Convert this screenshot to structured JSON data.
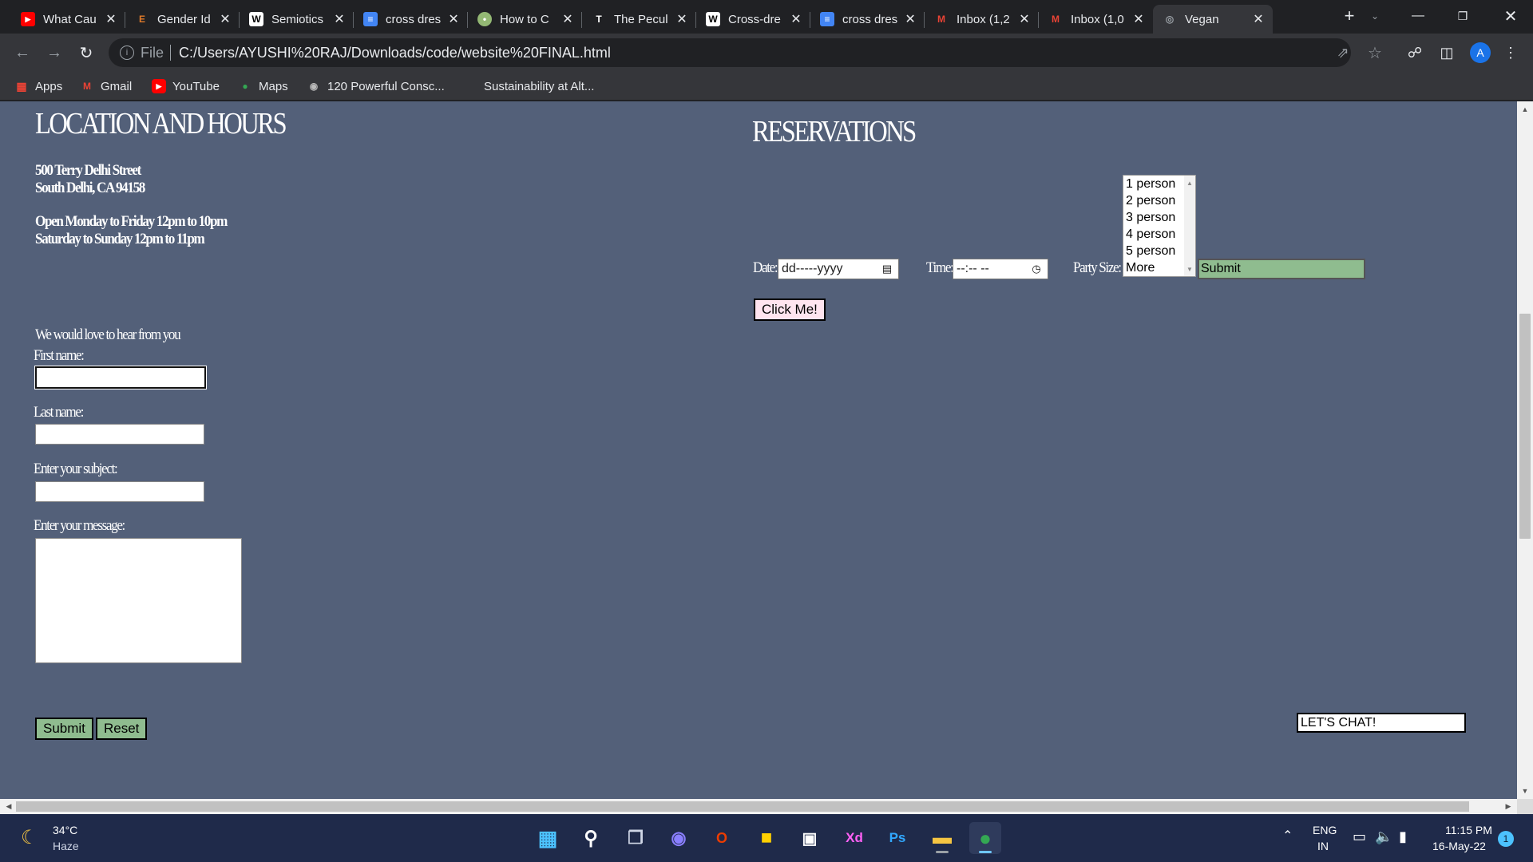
{
  "browser": {
    "tabs": [
      {
        "title": "What Cau",
        "icon": "youtube-icon",
        "color": "#ff0000"
      },
      {
        "title": "Gender Id",
        "icon": "e-letter-icon",
        "color": "#e07a2a"
      },
      {
        "title": "Semiotics",
        "icon": "wikipedia-icon",
        "color": "#ffffff"
      },
      {
        "title": "cross dres",
        "icon": "google-docs-icon",
        "color": "#4285f4"
      },
      {
        "title": "How to C",
        "icon": "wikihow-icon",
        "color": "#93b874"
      },
      {
        "title": "The Pecul",
        "icon": "nyt-icon",
        "color": "#ffffff"
      },
      {
        "title": "Cross-dre",
        "icon": "wikipedia-icon",
        "color": "#ffffff"
      },
      {
        "title": "cross dres",
        "icon": "google-docs-icon",
        "color": "#4285f4"
      },
      {
        "title": "Inbox (1,2",
        "icon": "gmail-icon",
        "color": "#ea4335"
      },
      {
        "title": "Inbox (1,0",
        "icon": "gmail-icon",
        "color": "#ea4335"
      },
      {
        "title": "Vegan",
        "icon": "globe-icon",
        "color": "#9aa0a6",
        "active": true
      }
    ],
    "scheme_label": "File",
    "url": "C:/Users/AYUSHI%20RAJ/Downloads/code/website%20FINAL.html",
    "profile_initial": "A",
    "bookmarks": [
      {
        "label": "Apps",
        "icon": "apps-grid-icon"
      },
      {
        "label": "Gmail",
        "icon": "gmail-icon"
      },
      {
        "label": "YouTube",
        "icon": "youtube-icon"
      },
      {
        "label": "Maps",
        "icon": "maps-icon"
      },
      {
        "label": "120 Powerful Consc...",
        "icon": "globe-icon"
      },
      {
        "label": "Sustainability at Alt...",
        "icon": "blank-page-icon"
      }
    ]
  },
  "page": {
    "location": {
      "heading": "LOCATION AND HOURS",
      "address_line1": "500 Terry Delhi Street",
      "address_line2": "South Delhi, CA 94158",
      "hours_line1": "Open Monday to Friday 12pm to 10pm",
      "hours_line2": "Saturday to Sunday 12pm to 11pm"
    },
    "contact_form": {
      "intro": "We would love to hear from you",
      "first_name_label": "First name:",
      "last_name_label": "Last name:",
      "subject_label": "Enter your subject:",
      "message_label": "Enter your message:",
      "submit_label": "Submit",
      "reset_label": "Reset"
    },
    "reservations": {
      "heading": "RESERVATIONS",
      "date_label": "Date:",
      "date_placeholder": "dd-----yyyy",
      "time_label": "Time:",
      "time_placeholder": "--:-- --",
      "party_label": "Party Size:",
      "party_options": [
        "1 person",
        "2 person",
        "3 person",
        "4 person",
        "5 person",
        "More"
      ],
      "submit_label": "Submit",
      "click_me_label": "Click Me!"
    },
    "chat": {
      "label": "LET'S CHAT!"
    },
    "colors": {
      "page_bg": "#536079",
      "button_green": "#8fbc8f",
      "button_pink": "#ffe4ef"
    }
  },
  "taskbar": {
    "weather_temp": "34°C",
    "weather_desc": "Haze",
    "language_line1": "ENG",
    "language_line2": "IN",
    "time": "11:15 PM",
    "date": "16-May-22",
    "notification_count": "1"
  }
}
